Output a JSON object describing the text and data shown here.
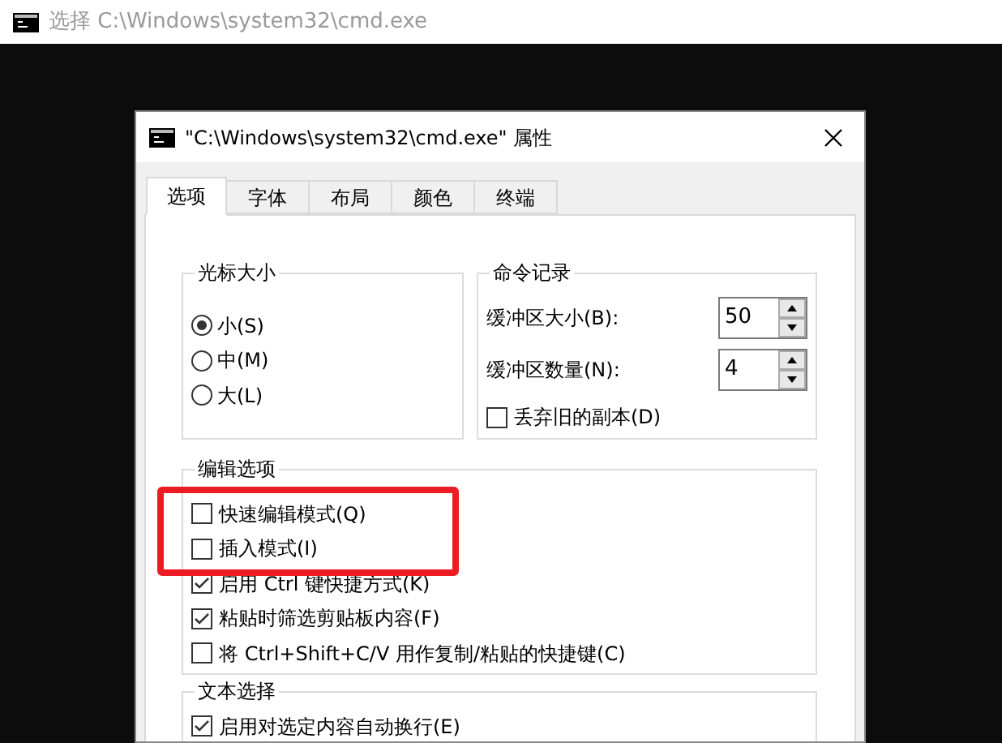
{
  "console_window": {
    "title": "选择 C:\\Windows\\system32\\cmd.exe"
  },
  "dialog": {
    "title": "\"C:\\Windows\\system32\\cmd.exe\" 属性"
  },
  "tabs": [
    {
      "label": "选项",
      "selected": true
    },
    {
      "label": "字体",
      "selected": false
    },
    {
      "label": "布局",
      "selected": false
    },
    {
      "label": "颜色",
      "selected": false
    },
    {
      "label": "终端",
      "selected": false
    }
  ],
  "cursor_size": {
    "title": "光标大小",
    "options": [
      {
        "label": "小(S)",
        "selected": true
      },
      {
        "label": "中(M)",
        "selected": false
      },
      {
        "label": "大(L)",
        "selected": false
      }
    ]
  },
  "command_history": {
    "title": "命令记录",
    "fields": [
      {
        "label": "缓冲区大小(B):",
        "value": "50"
      },
      {
        "label": "缓冲区数量(N):",
        "value": "4"
      }
    ],
    "discard_old": {
      "label": "丢弃旧的副本(D)",
      "checked": false
    }
  },
  "edit_options": {
    "title": "编辑选项",
    "options": [
      {
        "label": "快速编辑模式(Q)",
        "checked": false,
        "highlighted": true
      },
      {
        "label": "插入模式(I)",
        "checked": false,
        "highlighted": true
      },
      {
        "label": "启用 Ctrl 键快捷方式(K)",
        "checked": true,
        "highlighted": false
      },
      {
        "label": "粘贴时筛选剪贴板内容(F)",
        "checked": true,
        "highlighted": false
      },
      {
        "label": "将 Ctrl+Shift+C/V 用作复制/粘贴的快捷键(C)",
        "checked": false,
        "highlighted": false
      }
    ]
  },
  "text_selection": {
    "title": "文本选择",
    "options": [
      {
        "label": "启用对选定内容自动换行(E)",
        "checked": true
      }
    ]
  }
}
